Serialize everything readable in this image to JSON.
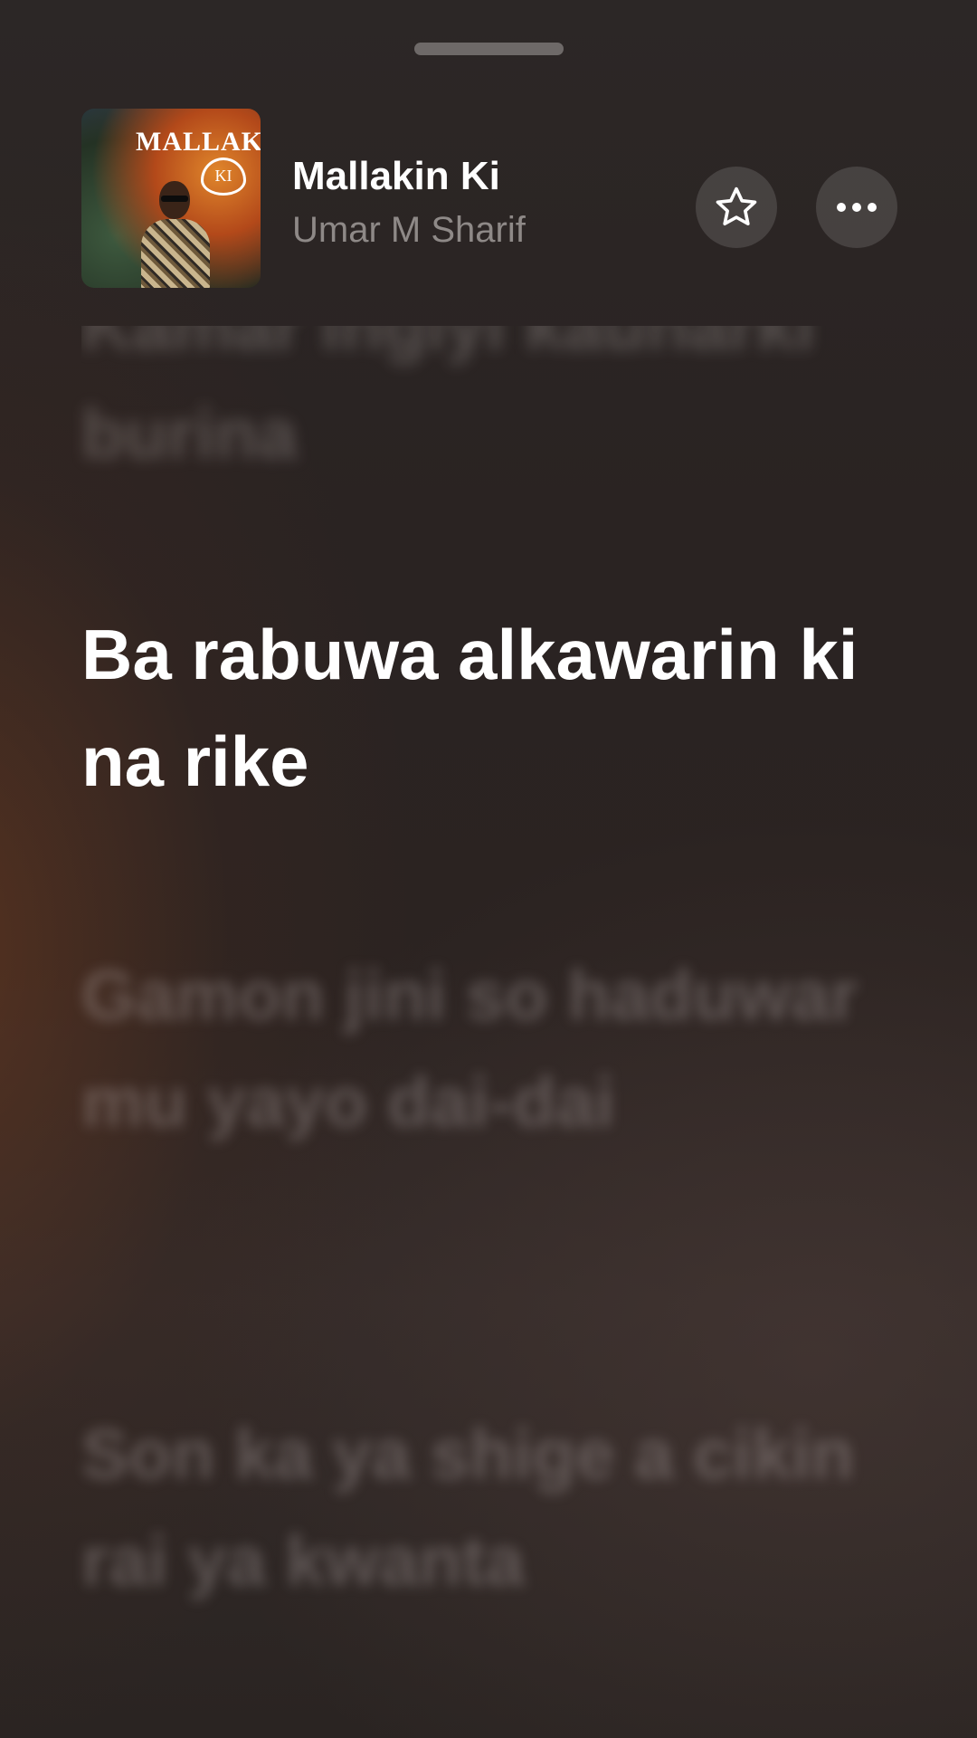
{
  "song": {
    "title": "Mallakin Ki",
    "artist": "Umar M Sharif",
    "artwork": {
      "logo_text": "MALLAKIN",
      "logo_sub": "KI"
    }
  },
  "actions": {
    "favorite_icon": "star-icon",
    "more_icon": "ellipsis-icon"
  },
  "lyrics": {
    "previous_partial": "Kamar ingiyi kaunarki",
    "previous": "burina",
    "current": "Ba rabuwa alkawarin ki na rike",
    "next": [
      "Gamon jini so haduwar mu yayo dai-dai",
      "Son ka ya shige a cikin rai ya kwanta"
    ]
  },
  "colors": {
    "background": "#2b2321",
    "current_lyric": "#ffffff",
    "artist_text": "#8e8987"
  }
}
